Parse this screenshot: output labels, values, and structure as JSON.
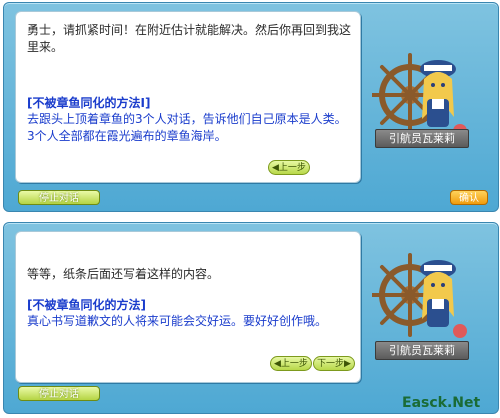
{
  "dialog1": {
    "body_text": "勇士，请抓紧时间！在附近估计就能解决。然后你再回到我这里来。",
    "quest_title": "[不被章鱼同化的方法I]",
    "quest_body": "去跟头上顶着章鱼的3个人对话，告诉他们自己原本是人类。3个人全部都在霞光遍布的章鱼海岸。",
    "prev_label": "上一步",
    "npc_name": "引航员瓦莱莉",
    "end_chat_label": "停止对话",
    "ok_label": "确认"
  },
  "dialog2": {
    "body_text": "等等，纸条后面还写着这样的内容。",
    "quest_title": "[不被章鱼同化的方法]",
    "quest_body": "真心书写道歉文的人将来可能会交好运。要好好创作哦。",
    "prev_label": "上一步",
    "next_label": "下一步",
    "npc_name": "引航员瓦莱莉",
    "end_chat_label": "停止对话"
  },
  "watermark": "Easck.Net"
}
